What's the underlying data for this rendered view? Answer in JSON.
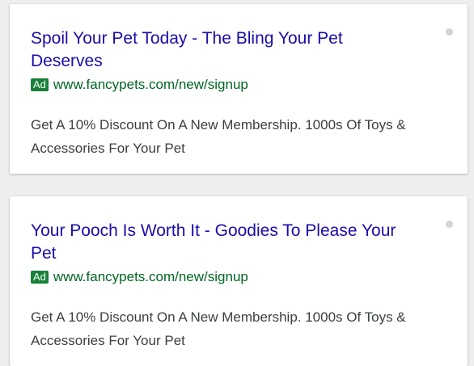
{
  "ads": [
    {
      "headline": "Spoil Your Pet Today - The Bling Your Pet Deserves",
      "badge": "Ad",
      "url": "www.fancypets.com/new/signup",
      "description": "Get A 10% Discount On A New Membership. 1000s Of Toys & Accessories For Your Pet",
      "info_icon": "info-icon"
    },
    {
      "headline": "Your Pooch Is Worth It - Goodies To Please Your Pet",
      "badge": "Ad",
      "url": "www.fancypets.com/new/signup",
      "description": "Get A 10% Discount On A New Membership. 1000s Of Toys & Accessories For Your Pet",
      "info_icon": "info-icon"
    }
  ],
  "colors": {
    "headline": "#1a0dab",
    "url": "#006621",
    "badge_bg": "#188038",
    "description": "#3c4043",
    "background": "#eeeeee"
  }
}
